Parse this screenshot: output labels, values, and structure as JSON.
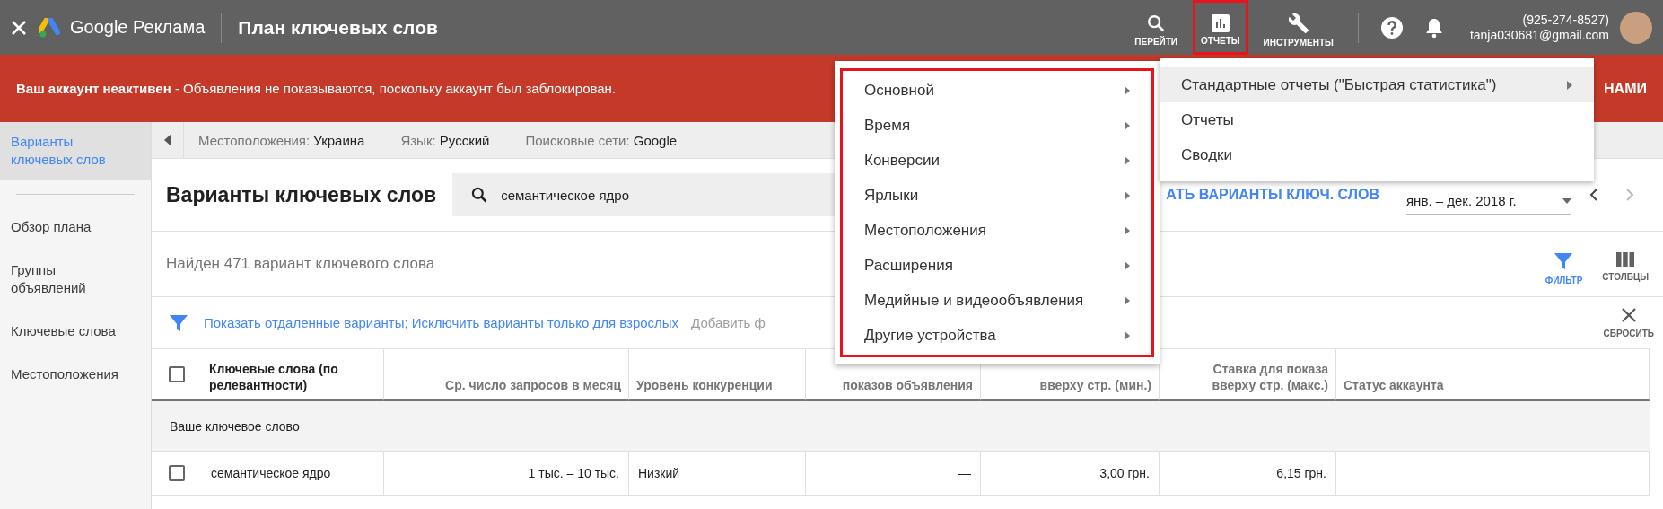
{
  "topbar": {
    "product": "Google Реклама",
    "title": "План ключевых слов",
    "tools": [
      {
        "label": "ПЕРЕЙТИ",
        "kind": "search",
        "outlined": false
      },
      {
        "label": "ОТЧЕТЫ",
        "kind": "reports",
        "outlined": true
      },
      {
        "label": "ИНСТРУМЕНТЫ",
        "kind": "tools",
        "outlined": false
      }
    ],
    "phone": "(925-274-8527)",
    "email": "tanja030681@gmail.com"
  },
  "banner": {
    "message": "**Ваш аккаунт неактивен** - Объявления не показываются, поскольку аккаунт был заблокирован.",
    "action": "НАМИ"
  },
  "sidebar": {
    "items": [
      {
        "label": "Варианты ключевых слов",
        "selected": true
      },
      {
        "label": "Обзор плана",
        "selected": false
      },
      {
        "label": "Группы объявлений",
        "selected": false
      },
      {
        "label": "Ключевые слова",
        "selected": false
      },
      {
        "label": "Местоположения",
        "selected": false
      }
    ]
  },
  "filters": [
    {
      "label": "Местоположения:",
      "value": "Украина"
    },
    {
      "label": "Язык:",
      "value": "Русский"
    },
    {
      "label": "Поисковые сети:",
      "value": "Google"
    }
  ],
  "heading": {
    "title": "Варианты ключевых слов",
    "search": {
      "value": "семантическое ядро"
    },
    "link": "АТЬ ВАРИАНТЫ КЛЮЧ. СЛОВ",
    "date_range": "янв. – дек. 2018 г."
  },
  "summary": "Найден 471 вариант ключевого слова",
  "actions": [
    {
      "label": "ФИЛЬТР",
      "kind": "filter",
      "active": true
    },
    {
      "label": "СТОЛБЦЫ",
      "kind": "columns",
      "active": false
    }
  ],
  "filter_links": "Показать отдаленные варианты; Исключить варианты только для взрослых",
  "add_filter": "Добавить ф",
  "reset": "СБРОСИТЬ",
  "table": {
    "all_checked": false,
    "columns": [
      {
        "label": "Ключевые слова (по релевантности)",
        "numeric": false,
        "bold": true
      },
      {
        "label": "Ср. число запросов в месяц",
        "numeric": true,
        "bold": false
      },
      {
        "label": "Уровень конкуренции",
        "numeric": false,
        "bold": false
      },
      {
        "label": "показов объявления",
        "numeric": true,
        "bold": false
      },
      {
        "label": "вверху стр. (мин.)",
        "numeric": true,
        "bold": false
      },
      {
        "label": "Ставка для показа вверху стр. (макс.)",
        "numeric": true,
        "bold": false
      },
      {
        "label": "Статус аккаунта",
        "numeric": false,
        "bold": false
      }
    ],
    "group": "Ваше ключевое слово",
    "rows": [
      {
        "checked": false,
        "cells": [
          "семантическое ядро",
          "1 тыс. – 10 тыс.",
          "Низкий",
          "—",
          "3,00 грн.",
          "6,15 грн.",
          ""
        ]
      }
    ]
  },
  "menus": [
    {
      "outlined": true,
      "items": [
        {
          "label": "Основной",
          "has_submenu": true,
          "selected": false
        },
        {
          "label": "Время",
          "has_submenu": true,
          "selected": false
        },
        {
          "label": "Конверсии",
          "has_submenu": true,
          "selected": false
        },
        {
          "label": "Ярлыки",
          "has_submenu": true,
          "selected": false
        },
        {
          "label": "Местоположения",
          "has_submenu": true,
          "selected": false
        },
        {
          "label": "Расширения",
          "has_submenu": true,
          "selected": false
        },
        {
          "label": "Медийные и видеообъявления",
          "has_submenu": true,
          "selected": false
        },
        {
          "label": "Другие устройства",
          "has_submenu": true,
          "selected": false
        }
      ]
    },
    {
      "outlined": false,
      "items": [
        {
          "label": "Стандартные отчеты (\"Быстрая статистика\")",
          "has_submenu": true,
          "selected": true
        },
        {
          "label": "Отчеты",
          "has_submenu": false,
          "selected": false
        },
        {
          "label": "Сводки",
          "has_submenu": false,
          "selected": false
        }
      ]
    }
  ]
}
